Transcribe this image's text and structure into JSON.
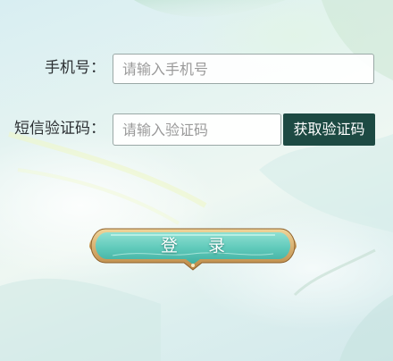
{
  "form": {
    "phone_label": "手机号：",
    "phone_placeholder": "请输入手机号",
    "code_label": "短信验证码：",
    "code_placeholder": "请输入验证码",
    "get_code_button": "获取验证码",
    "login_button": "登 录"
  },
  "colors": {
    "code_button_bg": "#1d4a43",
    "login_button_fill": "#5fc9ba",
    "login_button_border": "#c99a55"
  }
}
